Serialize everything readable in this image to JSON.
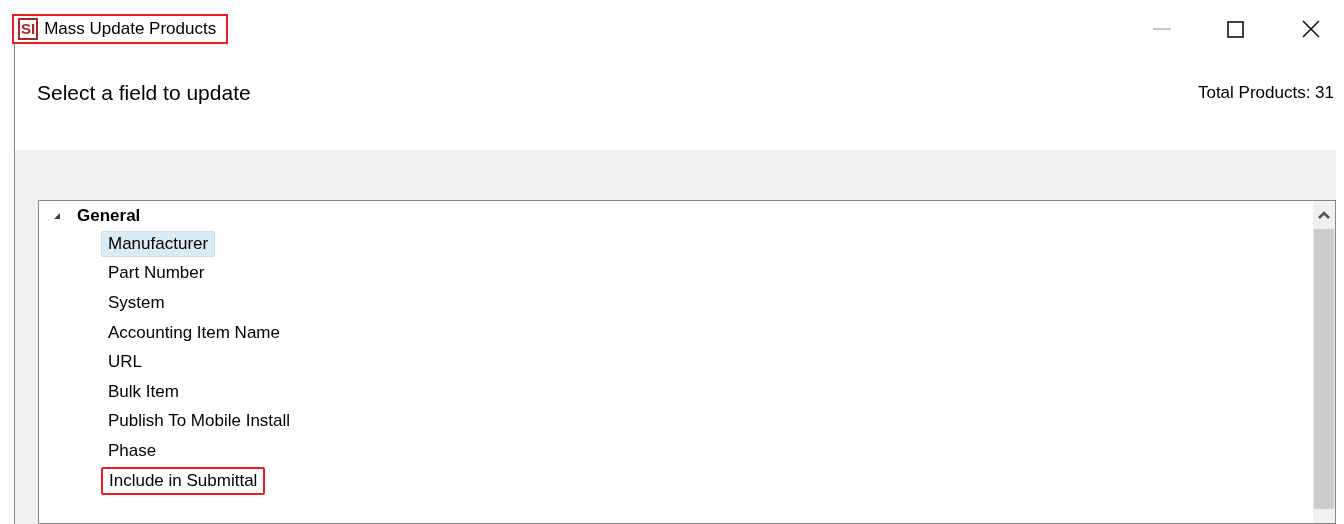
{
  "window": {
    "title": "Mass Update Products",
    "logo": "SI",
    "title_highlighted": true
  },
  "header": {
    "prompt": "Select a field to update",
    "total": "Total Products: 31"
  },
  "tree": [
    {
      "label": "General",
      "expanded": true,
      "children": [
        {
          "label": "Manufacturer",
          "selected": true,
          "highlighted": false
        },
        {
          "label": "Part Number",
          "selected": false,
          "highlighted": false
        },
        {
          "label": "System",
          "selected": false,
          "highlighted": false
        },
        {
          "label": "Accounting Item Name",
          "selected": false,
          "highlighted": false
        },
        {
          "label": "URL",
          "selected": false,
          "highlighted": false
        },
        {
          "label": "Bulk Item",
          "selected": false,
          "highlighted": false
        },
        {
          "label": "Publish To Mobile Install",
          "selected": false,
          "highlighted": false
        },
        {
          "label": "Phase",
          "selected": false,
          "highlighted": false
        },
        {
          "label": "Include in Submittal",
          "selected": false,
          "highlighted": true
        }
      ]
    }
  ]
}
